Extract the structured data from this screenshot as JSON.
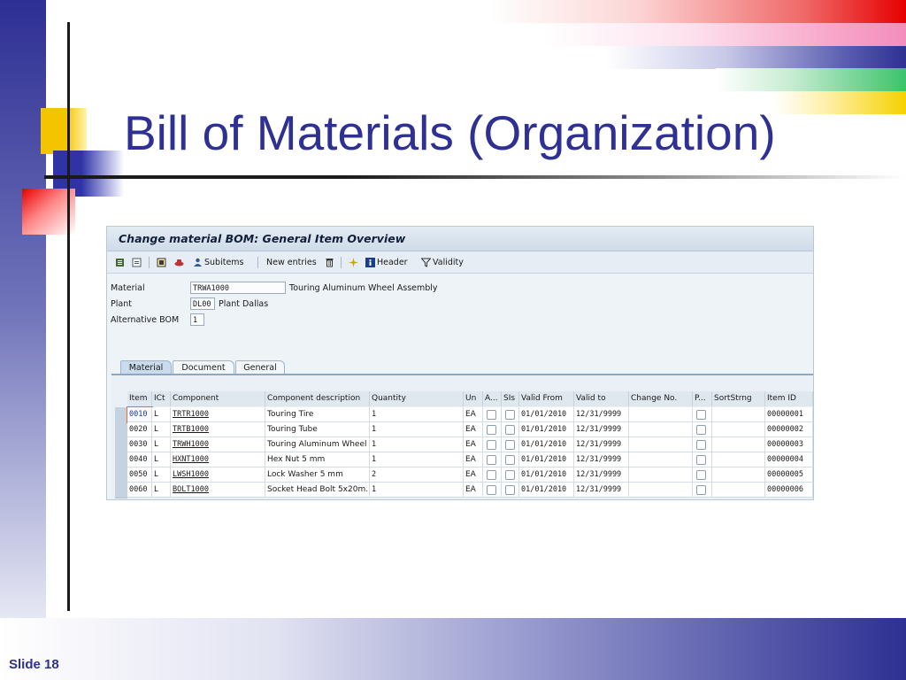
{
  "slide": {
    "title": "Bill of Materials (Organization)",
    "slide_number": "Slide 18"
  },
  "sap": {
    "window_title": "Change material BOM: General Item Overview",
    "toolbar": {
      "subitems": "Subitems",
      "new_entries": "New entries",
      "header": "Header",
      "validity": "Validity"
    },
    "header_fields": {
      "material_label": "Material",
      "material_value": "TRWA1000",
      "material_desc": "Touring Aluminum Wheel Assembly",
      "plant_label": "Plant",
      "plant_value": "DL00",
      "plant_desc": "Plant Dallas",
      "alt_bom_label": "Alternative BOM",
      "alt_bom_value": "1"
    },
    "tabs": [
      "Material",
      "Document",
      "General"
    ],
    "columns": [
      "Item",
      "ICt",
      "Component",
      "Component description",
      "Quantity",
      "Un",
      "A...",
      "SIs",
      "Valid From",
      "Valid to",
      "Change No.",
      "P...",
      "SortStrng",
      "Item ID"
    ],
    "rows": [
      {
        "item": "0010",
        "ict": "L",
        "component": "TRTR1000",
        "desc": "Touring Tire",
        "qty": "1",
        "un": "EA",
        "valid_from": "01/01/2010",
        "valid_to": "12/31/9999",
        "item_id": "00000001"
      },
      {
        "item": "0020",
        "ict": "L",
        "component": "TRTB1000",
        "desc": "Touring Tube",
        "qty": "1",
        "un": "EA",
        "valid_from": "01/01/2010",
        "valid_to": "12/31/9999",
        "item_id": "00000002"
      },
      {
        "item": "0030",
        "ict": "L",
        "component": "TRWH1000",
        "desc": "Touring Aluminum Wheel",
        "qty": "1",
        "un": "EA",
        "valid_from": "01/01/2010",
        "valid_to": "12/31/9999",
        "item_id": "00000003"
      },
      {
        "item": "0040",
        "ict": "L",
        "component": "HXNT1000",
        "desc": "Hex Nut 5 mm",
        "qty": "1",
        "un": "EA",
        "valid_from": "01/01/2010",
        "valid_to": "12/31/9999",
        "item_id": "00000004"
      },
      {
        "item": "0050",
        "ict": "L",
        "component": "LWSH1000",
        "desc": "Lock Washer 5 mm",
        "qty": "2",
        "un": "EA",
        "valid_from": "01/01/2010",
        "valid_to": "12/31/9999",
        "item_id": "00000005"
      },
      {
        "item": "0060",
        "ict": "L",
        "component": "BOLT1000",
        "desc": "Socket Head Bolt 5x20m...",
        "qty": "1",
        "un": "EA",
        "valid_from": "01/01/2010",
        "valid_to": "12/31/9999",
        "item_id": "00000006"
      }
    ]
  }
}
